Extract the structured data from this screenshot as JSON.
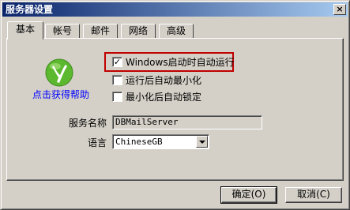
{
  "window": {
    "title": "服务器设置",
    "close_glyph": "×"
  },
  "tabs": [
    {
      "label": "基本",
      "active": true
    },
    {
      "label": "帐号",
      "active": false
    },
    {
      "label": "邮件",
      "active": false
    },
    {
      "label": "网络",
      "active": false
    },
    {
      "label": "高级",
      "active": false
    }
  ],
  "help": {
    "icon": "help-logo-icon",
    "link_text": "点击获得帮助"
  },
  "options": {
    "autostart": {
      "label": "Windows启动时自动运行",
      "checked": true
    },
    "minimize_after_run": {
      "label": "运行后自动最小化",
      "checked": false
    },
    "lock_after_minimize": {
      "label": "最小化后自动锁定",
      "checked": false
    }
  },
  "check_glyph": "✓",
  "server_name": {
    "label": "服务名称",
    "value": "DBMailServer"
  },
  "language": {
    "label": "语言",
    "value": "ChineseGB"
  },
  "buttons": {
    "ok": "确定(O)",
    "cancel": "取消(C)"
  },
  "colors": {
    "title_gradient_start": "#0a246a",
    "title_gradient_end": "#a6caf0",
    "highlight_box": "#c00000",
    "help_link": "#0000ff",
    "help_icon_green": "#5cb82e"
  }
}
